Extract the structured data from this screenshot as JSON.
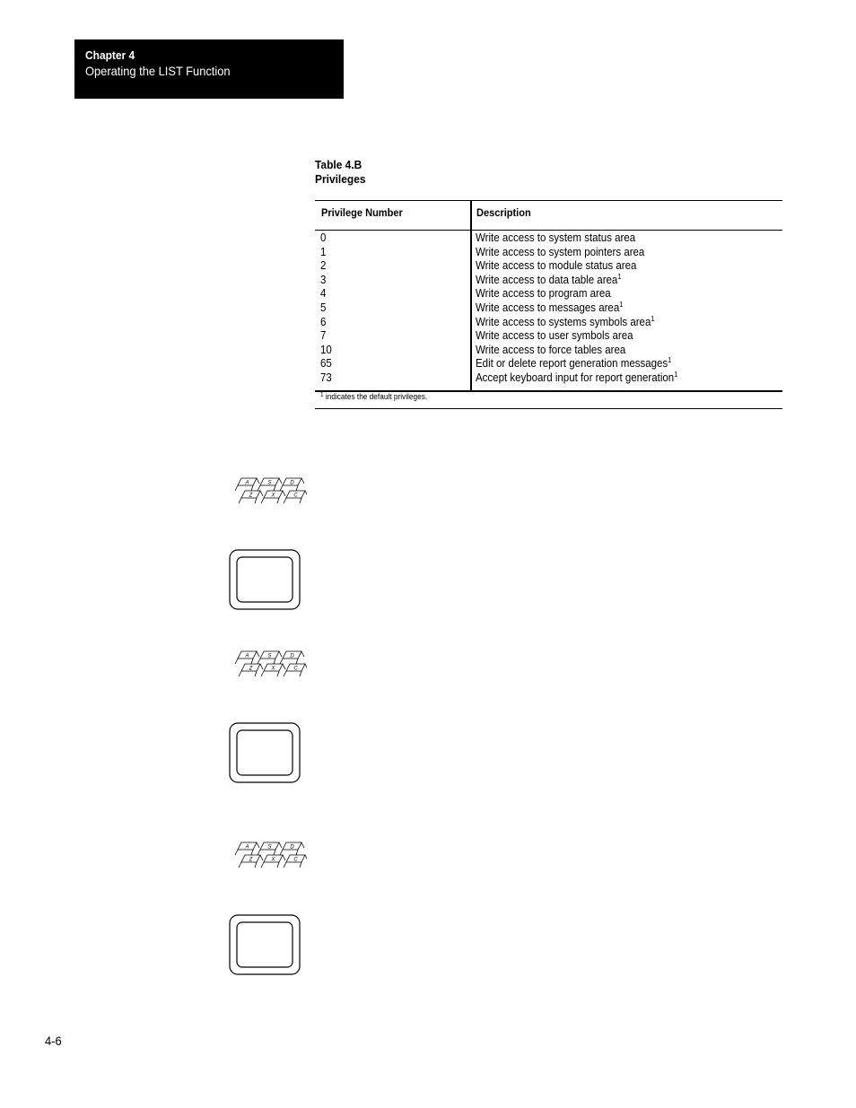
{
  "header": {
    "chapter": "Chapter 4",
    "subtitle": "Operating the LIST Function"
  },
  "table": {
    "label": "Table 4.B",
    "title": "Privileges",
    "columns": [
      "Privilege Number",
      "Description"
    ],
    "rows": [
      {
        "number": "0",
        "description": "Write access to system status area",
        "footnote": ""
      },
      {
        "number": "1",
        "description": "Write access to system pointers area",
        "footnote": ""
      },
      {
        "number": "2",
        "description": "Write access to module status area",
        "footnote": ""
      },
      {
        "number": "3",
        "description": "Write access to data table area",
        "footnote": "1"
      },
      {
        "number": "4",
        "description": "Write access to program area",
        "footnote": ""
      },
      {
        "number": "5",
        "description": "Write access to messages area",
        "footnote": "1"
      },
      {
        "number": "6",
        "description": "Write access to systems symbols area",
        "footnote": "1"
      },
      {
        "number": "7",
        "description": "Write access to user symbols area",
        "footnote": ""
      },
      {
        "number": "10",
        "description": "Write access to force tables area",
        "footnote": ""
      },
      {
        "number": "65",
        "description": "Edit or delete report generation messages",
        "footnote": "1"
      },
      {
        "number": "73",
        "description": "Accept keyboard input for report generation",
        "footnote": "1"
      }
    ],
    "footnote": {
      "marker": "1",
      "text": "indicates the default privileges."
    }
  },
  "icons": [
    {
      "type": "keyboard-icon",
      "keys": [
        "A",
        "S",
        "D",
        "Z",
        "X",
        "C"
      ]
    },
    {
      "type": "screen-icon"
    },
    {
      "type": "keyboard-icon",
      "keys": [
        "A",
        "S",
        "D",
        "Z",
        "X",
        "C"
      ]
    },
    {
      "type": "screen-icon"
    },
    {
      "type": "keyboard-icon",
      "keys": [
        "A",
        "S",
        "D",
        "Z",
        "X",
        "C"
      ]
    },
    {
      "type": "screen-icon"
    }
  ],
  "footer": {
    "page_number": "4-6"
  }
}
